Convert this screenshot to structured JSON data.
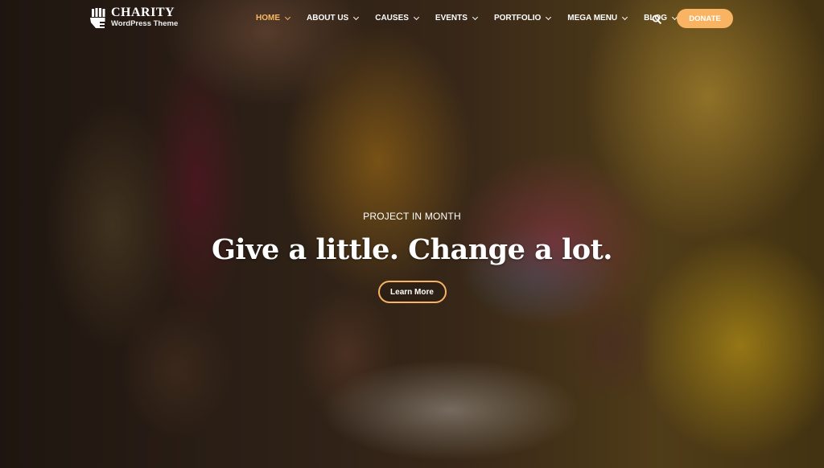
{
  "brand": {
    "title": "CHARITY",
    "subtitle": "WordPress Theme",
    "icon": "hand-icon"
  },
  "nav": {
    "items": [
      {
        "label": "HOME",
        "active": true,
        "has_dropdown": true
      },
      {
        "label": "ABOUT US",
        "active": false,
        "has_dropdown": true
      },
      {
        "label": "CAUSES",
        "active": false,
        "has_dropdown": true
      },
      {
        "label": "EVENTS",
        "active": false,
        "has_dropdown": true
      },
      {
        "label": "PORTFOLIO",
        "active": false,
        "has_dropdown": true
      },
      {
        "label": "MEGA MENU",
        "active": false,
        "has_dropdown": true
      },
      {
        "label": "BLOG",
        "active": false,
        "has_dropdown": true
      }
    ],
    "search_icon": "search-icon",
    "donate_label": "DONATE"
  },
  "hero": {
    "eyebrow": "PROJECT IN MONTH",
    "headline": "Give a little. Change a lot.",
    "cta_label": "Learn More"
  },
  "colors": {
    "accent": "#f8b462",
    "active_nav": "#f8b864",
    "text": "#ffffff"
  }
}
